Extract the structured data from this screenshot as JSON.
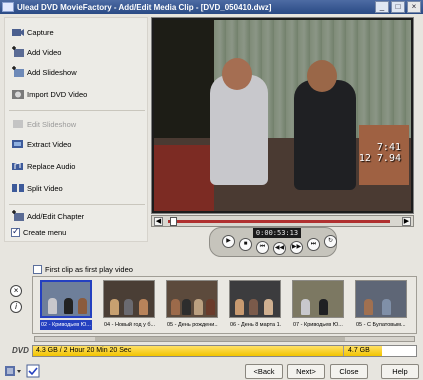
{
  "window": {
    "title": "Ulead DVD MovieFactory - Add/Edit Media Clip - [DVD_050410.dwz]",
    "min_glyph": "_",
    "max_glyph": "□",
    "close_glyph": "×"
  },
  "tasks": {
    "capture": "Capture",
    "add_video": "Add Video",
    "add_slideshow": "Add Slideshow",
    "import_dvd_video": "Import DVD Video",
    "edit_slideshow": "Edit Slideshow",
    "extract_video": "Extract Video",
    "replace_audio": "Replace Audio",
    "split_video": "Split Video",
    "add_edit_chapter": "Add/Edit Chapter",
    "create_menu": "Create menu"
  },
  "preview": {
    "stamp_time": "7:41",
    "stamp_date": "12 7.94",
    "timecode": "0:00:53:13"
  },
  "player": {
    "play": "▶",
    "stop": "■",
    "prev": "⏮",
    "step_back": "◀◀",
    "step_fwd": "▶▶",
    "next": "⏭",
    "loop": "↻"
  },
  "first_clip_label": "First clip as first play video",
  "tools": {
    "delete_glyph": "×",
    "info_glyph": "i"
  },
  "clips": [
    {
      "label": "02 - Криводьев Ю..."
    },
    {
      "label": "04 - Новый год у б..."
    },
    {
      "label": "05 - День рождени..."
    },
    {
      "label": "06 - День 8 марта 1..."
    },
    {
      "label": "07 - Криводьев Ю..."
    },
    {
      "label": "05 - С Булатовым..."
    }
  ],
  "dvd": {
    "label": "DVD",
    "used_text": "4.3 GB / 2 Hour 20 Min 20 Sec",
    "capacity": "4.7 GB",
    "fill_fraction": 0.91
  },
  "buttons": {
    "back": "<Back",
    "next": "Next>",
    "close": "Close",
    "help": "Help"
  },
  "colors": {
    "selection": "#2440c0",
    "disk_fill": "#f2c400",
    "scrub": "#b03030"
  }
}
